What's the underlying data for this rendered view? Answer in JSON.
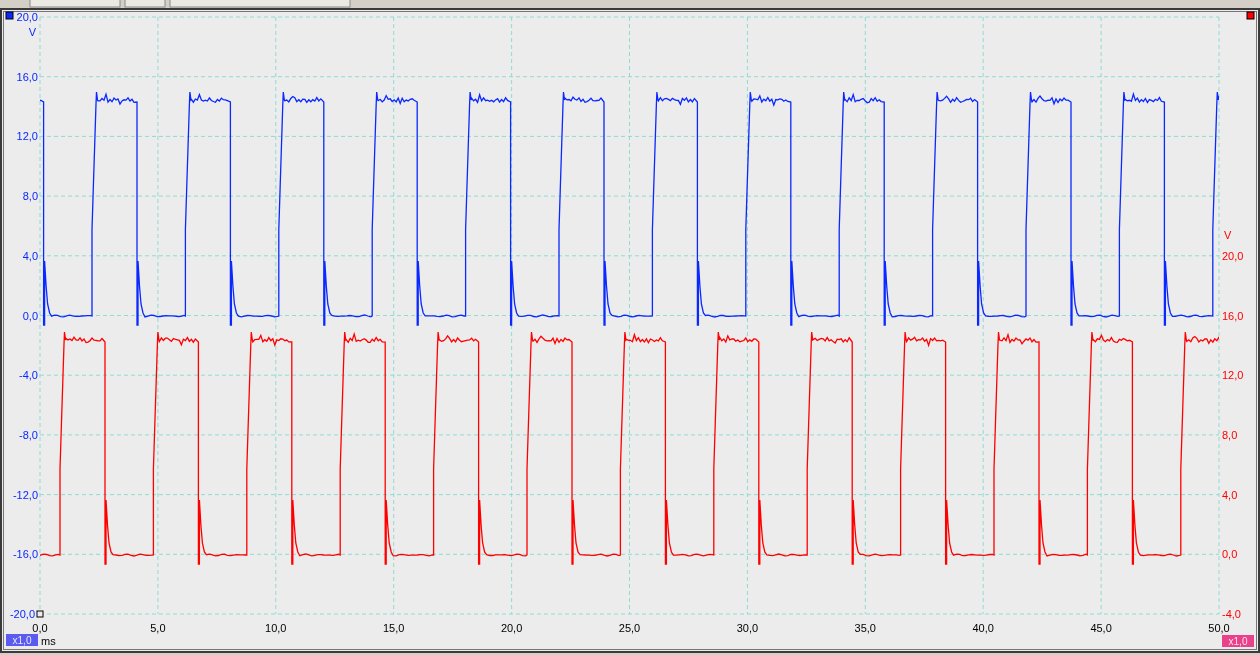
{
  "time_axis": {
    "unit": "ms",
    "ticks": [
      "0,0",
      "5,0",
      "10,0",
      "15,0",
      "20,0",
      "25,0",
      "30,0",
      "35,0",
      "40,0",
      "45,0",
      "50,0"
    ]
  },
  "channels": [
    {
      "color": "#0a28ff",
      "unit": "V",
      "ticks": [
        "20,0",
        "16,0",
        "12,0",
        "8,0",
        "4,0",
        "0,0",
        "-4,0",
        "-8,0",
        "-12,0",
        "-16,0",
        "-20,0"
      ],
      "badge": {
        "text": "x1,0",
        "color": "#5b5bef"
      }
    },
    {
      "color": "#ff0000",
      "unit": "V",
      "ticks": [
        "20,0",
        "16,0",
        "12,0",
        "8,0",
        "4,0",
        "0,0",
        "-4,0"
      ],
      "badge": {
        "text": "x1,0",
        "color": "#e8428a"
      }
    }
  ]
}
